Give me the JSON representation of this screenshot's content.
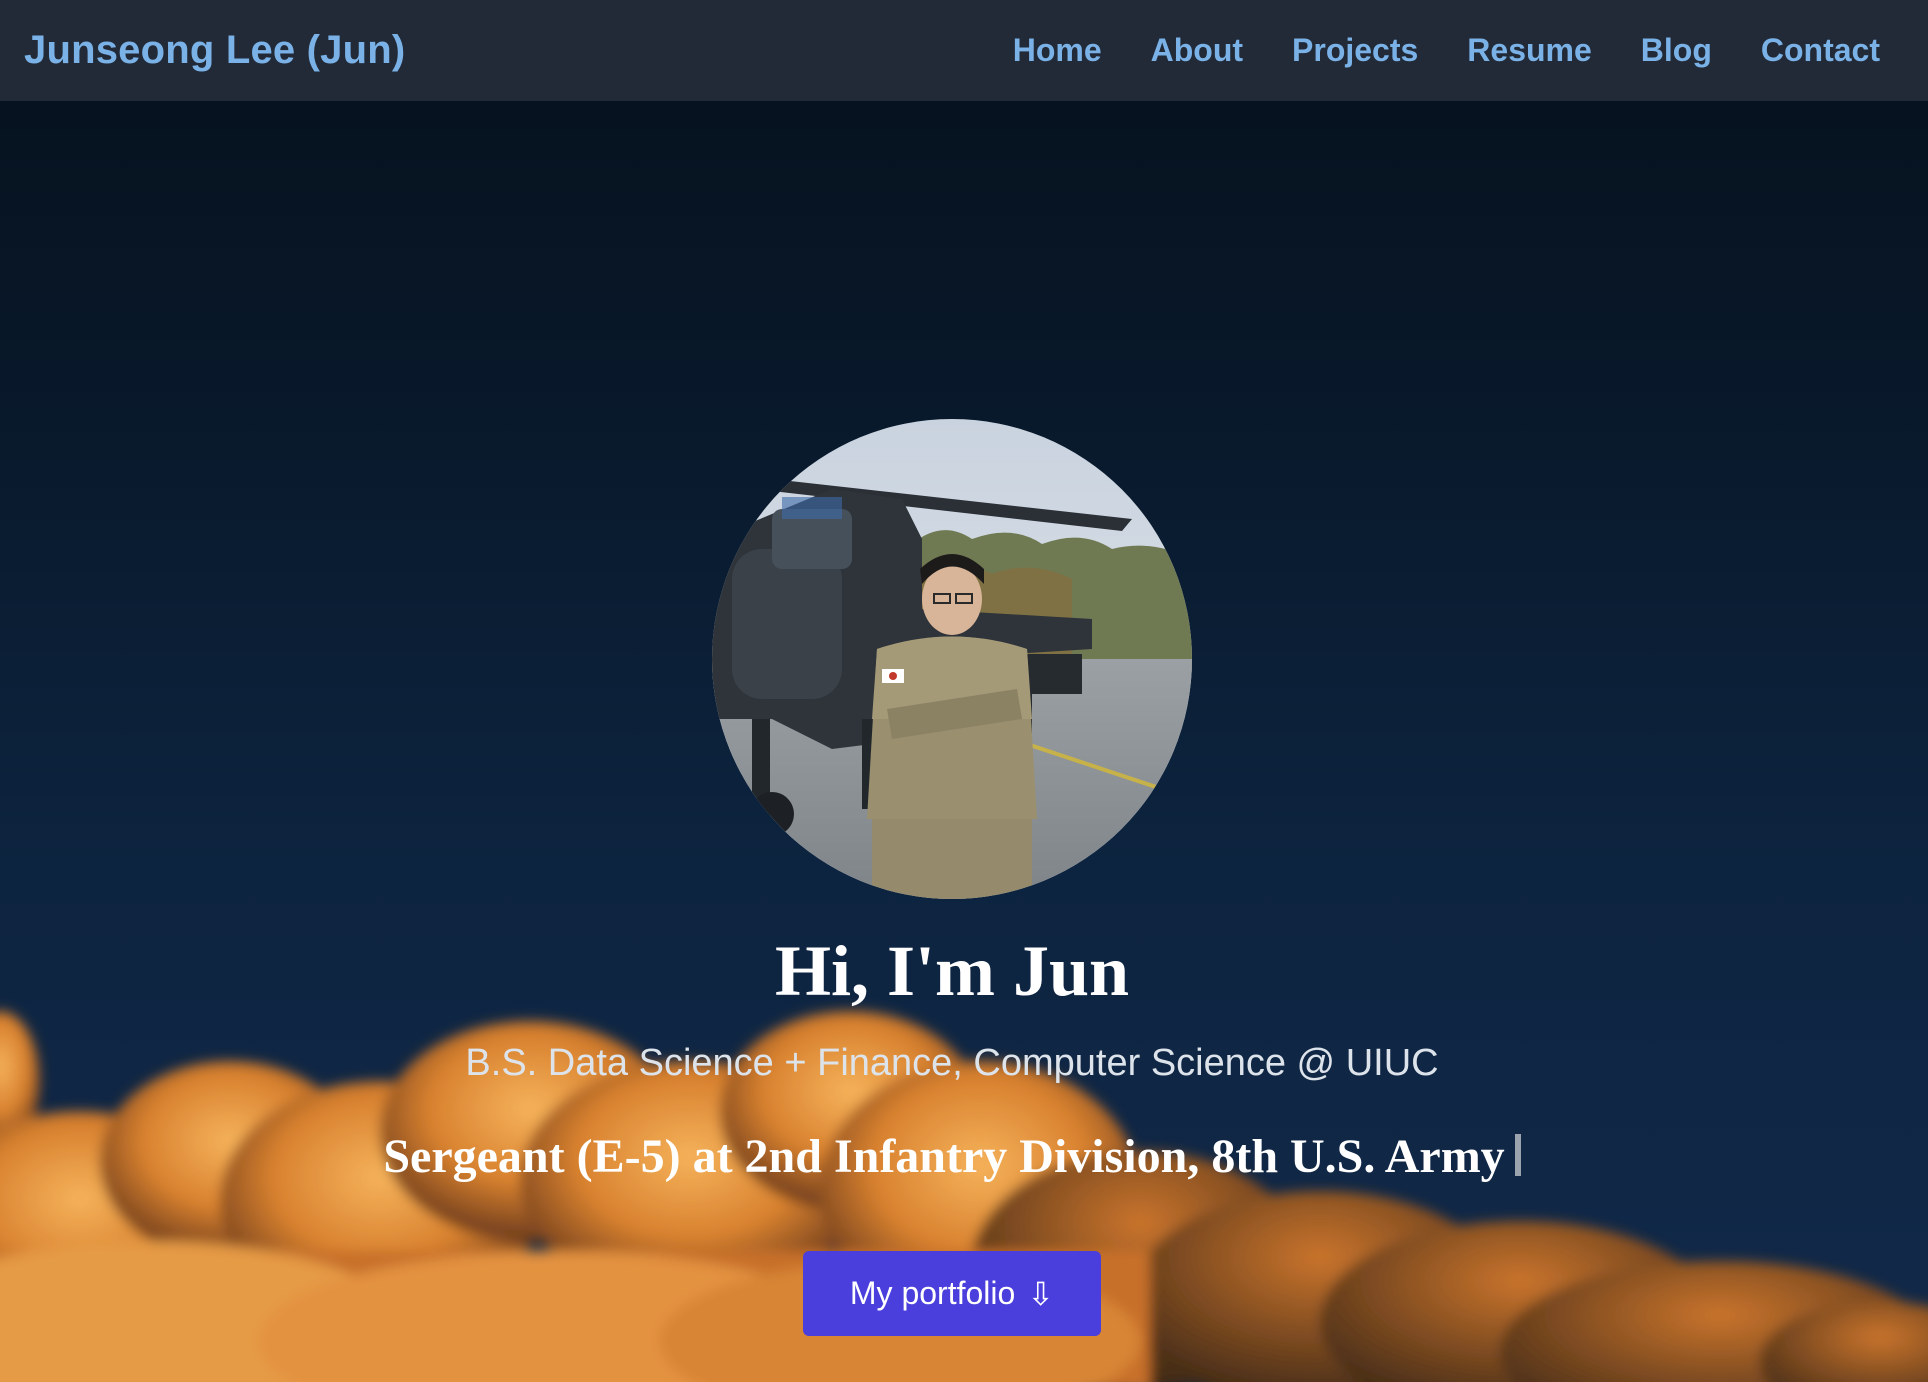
{
  "navbar": {
    "brand": "Junseong Lee (Jun)",
    "links": [
      {
        "label": "Home"
      },
      {
        "label": "About"
      },
      {
        "label": "Projects"
      },
      {
        "label": "Resume"
      },
      {
        "label": "Blog"
      },
      {
        "label": "Contact"
      }
    ]
  },
  "hero": {
    "title": "Hi, I'm Jun",
    "subtitle": "B.S. Data Science + Finance, Computer Science @ UIUC",
    "typed_text": "Sergeant (E-5) at 2nd Infantry Division, 8th U.S. Army",
    "cta_label": "My portfolio",
    "cta_icon": "⇩",
    "avatar_icon": "profile-photo"
  },
  "colors": {
    "navbar_bg": "#222a37",
    "nav_link": "#7ab2e8",
    "cta_bg": "#4a3fdc",
    "sky_top": "#06121f",
    "cloud": "#e0913a"
  }
}
